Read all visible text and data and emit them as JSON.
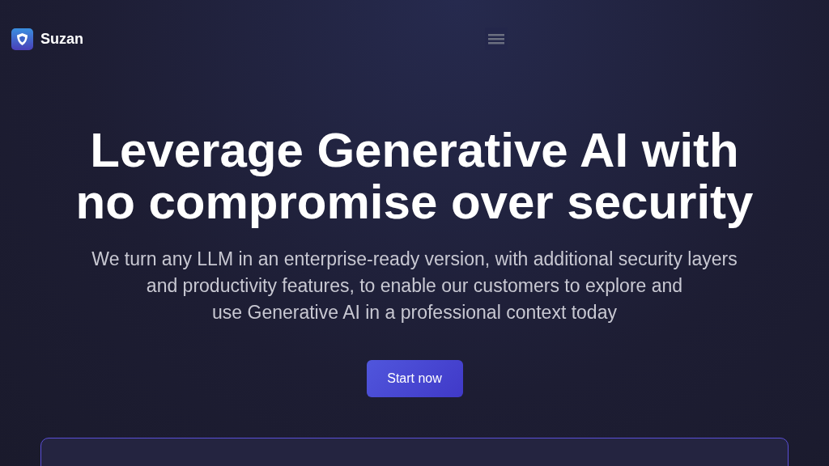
{
  "brand": {
    "name": "Suzan"
  },
  "hero": {
    "title_lines": [
      "Leverage Generative AI with",
      "no compromise over security"
    ],
    "subtitle_lines": [
      "We turn any LLM in an enterprise-ready version, with additional security layers",
      "and productivity features, to enable our customers to explore and",
      "use Generative AI in a professional context today"
    ],
    "cta": "Start now"
  }
}
